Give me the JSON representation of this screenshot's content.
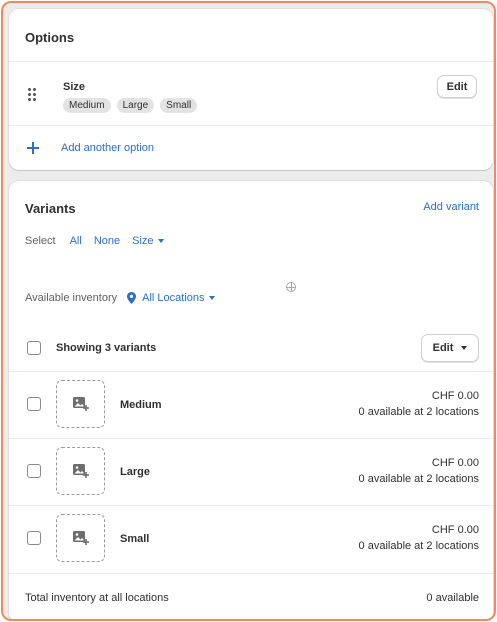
{
  "options": {
    "title": "Options",
    "option": {
      "name": "Size",
      "values": [
        "Medium",
        "Large",
        "Small"
      ],
      "edit_label": "Edit"
    },
    "add_option_label": "Add another option"
  },
  "variants": {
    "title": "Variants",
    "add_variant_label": "Add variant",
    "select": {
      "label": "Select",
      "all": "All",
      "none": "None",
      "size": "Size"
    },
    "inventory": {
      "label": "Available inventory",
      "locations": "All Locations"
    },
    "header": {
      "showing": "Showing 3 variants",
      "edit_label": "Edit"
    },
    "rows": [
      {
        "name": "Medium",
        "price": "CHF 0.00",
        "availability": "0 available at 2 locations"
      },
      {
        "name": "Large",
        "price": "CHF 0.00",
        "availability": "0 available at 2 locations"
      },
      {
        "name": "Small",
        "price": "CHF 0.00",
        "availability": "0 available at 2 locations"
      }
    ],
    "total": {
      "label": "Total inventory at all locations",
      "value": "0 available"
    }
  },
  "colors": {
    "accent": "#2c6ecb",
    "frame_border": "#ef8a5a",
    "background": "#ececec"
  },
  "icons": [
    "drag-handle-icon",
    "plus-icon",
    "chevron-down-icon",
    "location-pin-icon",
    "crosshair-icon",
    "image-add-icon"
  ]
}
